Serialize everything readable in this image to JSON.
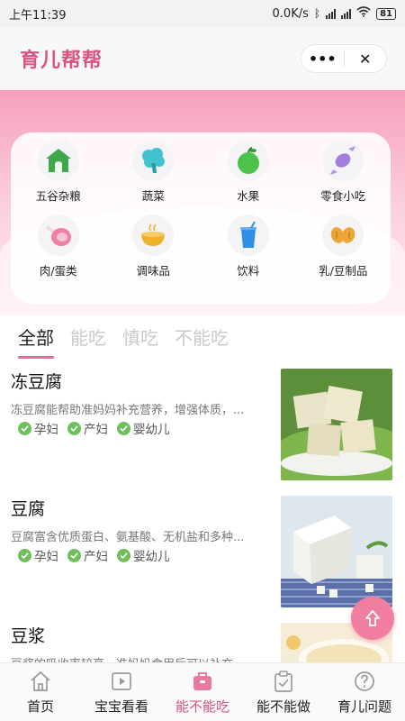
{
  "status_bar": {
    "time": "上午11:39",
    "network_speed": "0.0K/s",
    "battery": "81"
  },
  "header": {
    "title": "育儿帮帮",
    "more_label": "•••",
    "close_label": "✕"
  },
  "categories": [
    {
      "label": "五谷杂粮",
      "icon": "house-grain-icon",
      "color": "#3fa84a"
    },
    {
      "label": "蔬菜",
      "icon": "broccoli-icon",
      "color": "#43c3cf"
    },
    {
      "label": "水果",
      "icon": "apple-icon",
      "color": "#4cc24a"
    },
    {
      "label": "零食小吃",
      "icon": "candy-icon",
      "color": "#a57ddc"
    },
    {
      "label": "肉/蛋类",
      "icon": "ham-icon",
      "color": "#ef7fa4"
    },
    {
      "label": "调味品",
      "icon": "seasoning-bowl-icon",
      "color": "#f0b02a"
    },
    {
      "label": "饮料",
      "icon": "drink-cup-icon",
      "color": "#2f8fe8"
    },
    {
      "label": "乳/豆制品",
      "icon": "beans-icon",
      "color": "#eba636"
    }
  ],
  "tabs": [
    {
      "label": "全部",
      "active": true
    },
    {
      "label": "能吃",
      "active": false
    },
    {
      "label": "慎吃",
      "active": false
    },
    {
      "label": "不能吃",
      "active": false
    }
  ],
  "foods": [
    {
      "name": "冻豆腐",
      "desc": "冻豆腐能帮助准妈妈补充营养，增强体质，...",
      "tags": [
        "孕妇",
        "产妇",
        "婴幼儿"
      ],
      "image": "frozen-tofu-photo"
    },
    {
      "name": "豆腐",
      "desc": "豆腐富含优质蛋白、氨基酸、无机盐和多种...",
      "tags": [
        "孕妇",
        "产妇",
        "婴幼儿"
      ],
      "image": "tofu-photo"
    },
    {
      "name": "豆浆",
      "desc": "豆浆的吸收率较高，准妈妈食用后可以补充...",
      "tags": [],
      "image": "soy-milk-photo"
    }
  ],
  "bottom_nav": [
    {
      "label": "首页",
      "icon": "home-icon",
      "active": false
    },
    {
      "label": "宝宝看看",
      "icon": "video-play-icon",
      "active": false
    },
    {
      "label": "能不能吃",
      "icon": "lunchbox-icon",
      "active": true
    },
    {
      "label": "能不能做",
      "icon": "clipboard-check-icon",
      "active": false
    },
    {
      "label": "育儿问题",
      "icon": "question-icon",
      "active": false
    }
  ],
  "colors": {
    "accent": "#d9537f",
    "fab": "#f07f9f",
    "check": "#6fbf5a",
    "tab_underline": "#e56f92"
  }
}
